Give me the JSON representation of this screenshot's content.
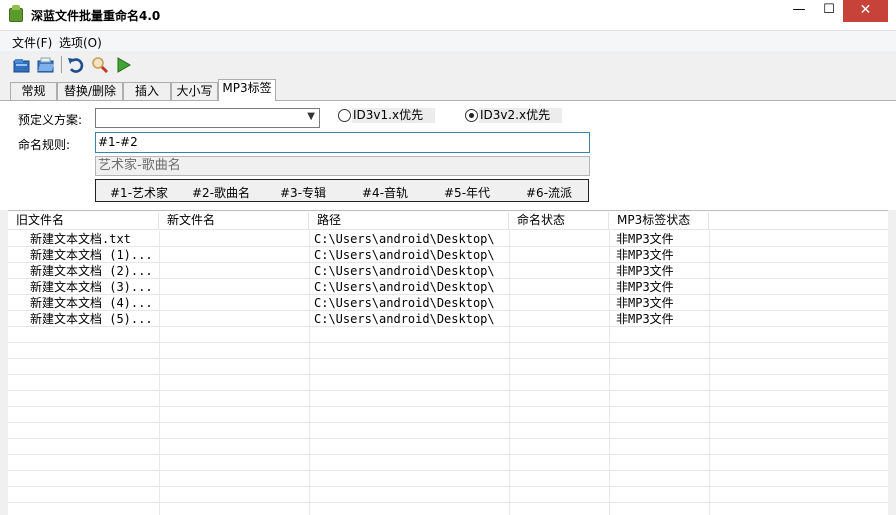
{
  "window": {
    "title": "深蓝文件批量重命名4.0",
    "minimize": "—",
    "maximize": "☐",
    "close": "✕"
  },
  "menu": [
    {
      "label": "文件(F)"
    },
    {
      "label": "选项(O)"
    }
  ],
  "toolbar": {
    "icons": [
      "open-file-icon",
      "open-folder-icon",
      "undo-icon",
      "search-icon",
      "run-icon"
    ]
  },
  "tabs": [
    {
      "label": "常规"
    },
    {
      "label": "替换/删除"
    },
    {
      "label": "插入"
    },
    {
      "label": "大小写"
    },
    {
      "label": "MP3标签",
      "active": true
    }
  ],
  "mp3_panel": {
    "preset_label": "预定义方案:",
    "preset_value": "",
    "id3v1_label": "ID3v1.x优先",
    "id3v1_selected": false,
    "id3v2_label": "ID3v2.x优先",
    "id3v2_selected": true,
    "rule_label": "命名规则:",
    "rule_value": "#1-#2",
    "preview_value": "艺术家-歌曲名",
    "tokens": [
      "#1-艺术家",
      "#2-歌曲名",
      "#3-专辑",
      "#4-音轨",
      "#5-年代",
      "#6-流派"
    ]
  },
  "list": {
    "columns": [
      "旧文件名",
      "新文件名",
      "路径",
      "命名状态",
      "MP3标签状态"
    ],
    "rows": [
      {
        "old": "新建文本文档.txt",
        "new": "",
        "path": "C:\\Users\\android\\Desktop\\",
        "status": "",
        "mp3": "非MP3文件"
      },
      {
        "old": "新建文本文档 (1)...",
        "new": "",
        "path": "C:\\Users\\android\\Desktop\\",
        "status": "",
        "mp3": "非MP3文件"
      },
      {
        "old": "新建文本文档 (2)...",
        "new": "",
        "path": "C:\\Users\\android\\Desktop\\",
        "status": "",
        "mp3": "非MP3文件"
      },
      {
        "old": "新建文本文档 (3)...",
        "new": "",
        "path": "C:\\Users\\android\\Desktop\\",
        "status": "",
        "mp3": "非MP3文件"
      },
      {
        "old": "新建文本文档 (4)...",
        "new": "",
        "path": "C:\\Users\\android\\Desktop\\",
        "status": "",
        "mp3": "非MP3文件"
      },
      {
        "old": "新建文本文档 (5)...",
        "new": "",
        "path": "C:\\Users\\android\\Desktop\\",
        "status": "",
        "mp3": "非MP3文件"
      }
    ]
  }
}
